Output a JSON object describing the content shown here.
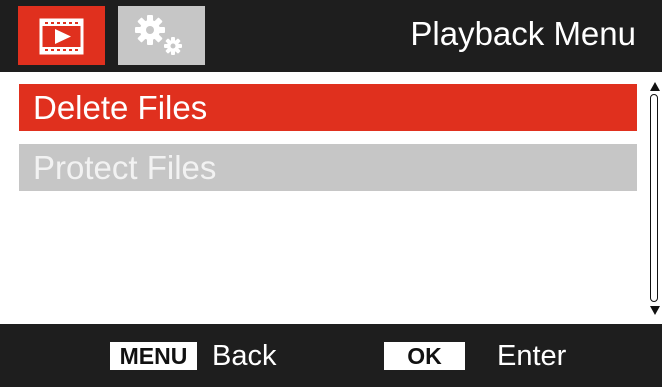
{
  "header": {
    "title": "Playback Menu",
    "tabs": [
      {
        "name": "playback",
        "icon": "video-playback-icon",
        "active": true,
        "color": "#e0301e"
      },
      {
        "name": "settings",
        "icon": "gears-icon",
        "active": false,
        "color": "#c6c6c6"
      }
    ]
  },
  "menu": {
    "items": [
      {
        "label": "Delete Files",
        "selected": true
      },
      {
        "label": "Protect Files",
        "selected": false
      }
    ]
  },
  "footer": {
    "menu_key": "MENU",
    "menu_action": "Back",
    "ok_key": "OK",
    "ok_action": "Enter"
  },
  "colors": {
    "accent": "#e0301e",
    "bar": "#1e1e1e",
    "inactive": "#c6c6c6"
  }
}
